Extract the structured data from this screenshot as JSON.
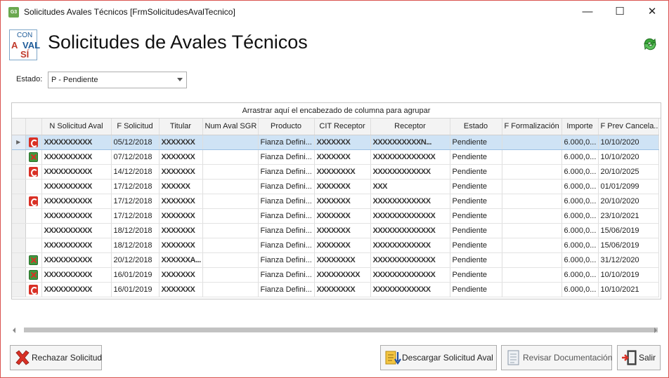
{
  "window": {
    "title": "Solicitudes Avales Técnicos [FrmSolicitudesAvalTecnico]",
    "app_icon_text": "G3",
    "minimize": "—",
    "maximize": "☐",
    "close": "✕"
  },
  "header": {
    "logo": {
      "line1": "CON",
      "line2": "A",
      "line3": "VAL",
      "line4": "SÍ"
    },
    "title": "Solicitudes de Avales Técnicos"
  },
  "filter": {
    "label": "Estado:",
    "value": "P - Pendiente"
  },
  "grid": {
    "group_panel": "Arrastrar aquí el encabezado de columna para agrupar",
    "columns": [
      "N Solicitud Aval",
      "F Solicitud",
      "Titular",
      "Num Aval SGR",
      "Producto",
      "CIT Receptor",
      "Receptor",
      "Estado",
      "F Formalización",
      "Importe",
      "F Prev Cancela..."
    ],
    "rows": [
      {
        "icon": "C",
        "n": "XXXXXXXXXX",
        "f": "05/12/2018",
        "titular": "XXXXXXX",
        "num": "",
        "producto": "Fianza Defini...",
        "cit": "XXXXXXX",
        "receptor": "XXXXXXXXXXN...",
        "estado": "Pendiente",
        "fform": "",
        "importe": "6.000,0...",
        "fprev": "10/10/2020"
      },
      {
        "icon": "X",
        "n": "XXXXXXXXXX",
        "f": "07/12/2018",
        "titular": "XXXXXXX",
        "num": "",
        "producto": "Fianza Defini...",
        "cit": "XXXXXXX",
        "receptor": "XXXXXXXXXXXXX",
        "estado": "Pendiente",
        "fform": "",
        "importe": "6.000,0...",
        "fprev": "10/10/2020"
      },
      {
        "icon": "C",
        "n": "XXXXXXXXXX",
        "f": "14/12/2018",
        "titular": "XXXXXXX",
        "num": "",
        "producto": "Fianza Defini...",
        "cit": "XXXXXXXX",
        "receptor": "XXXXXXXXXXXX",
        "estado": "Pendiente",
        "fform": "",
        "importe": "6.000,0...",
        "fprev": "20/10/2025"
      },
      {
        "icon": "",
        "n": "XXXXXXXXXX",
        "f": "17/12/2018",
        "titular": "XXXXXX",
        "num": "",
        "producto": "Fianza Defini...",
        "cit": "XXXXXXX",
        "receptor": "XXX",
        "estado": "Pendiente",
        "fform": "",
        "importe": "6.000,0...",
        "fprev": "01/01/2099"
      },
      {
        "icon": "C",
        "n": "XXXXXXXXXX",
        "f": "17/12/2018",
        "titular": "XXXXXXX",
        "num": "",
        "producto": "Fianza Defini...",
        "cit": "XXXXXXX",
        "receptor": "XXXXXXXXXXXX",
        "estado": "Pendiente",
        "fform": "",
        "importe": "6.000,0...",
        "fprev": "20/10/2020"
      },
      {
        "icon": "",
        "n": "XXXXXXXXXX",
        "f": "17/12/2018",
        "titular": "XXXXXXX",
        "num": "",
        "producto": "Fianza Defini...",
        "cit": "XXXXXXX",
        "receptor": "XXXXXXXXXXXXX",
        "estado": "Pendiente",
        "fform": "",
        "importe": "6.000,0...",
        "fprev": "23/10/2021"
      },
      {
        "icon": "",
        "n": "XXXXXXXXXX",
        "f": "18/12/2018",
        "titular": "XXXXXXX",
        "num": "",
        "producto": "Fianza Defini...",
        "cit": "XXXXXXX",
        "receptor": "XXXXXXXXXXXXX",
        "estado": "Pendiente",
        "fform": "",
        "importe": "6.000,0...",
        "fprev": "15/06/2019"
      },
      {
        "icon": "",
        "n": "XXXXXXXXXX",
        "f": "18/12/2018",
        "titular": "XXXXXXX",
        "num": "",
        "producto": "Fianza Defini...",
        "cit": "XXXXXXX",
        "receptor": "XXXXXXXXXXXX",
        "estado": "Pendiente",
        "fform": "",
        "importe": "6.000,0...",
        "fprev": "15/06/2019"
      },
      {
        "icon": "X",
        "n": "XXXXXXXXXX",
        "f": "20/12/2018",
        "titular": "XXXXXXA...",
        "num": "",
        "producto": "Fianza Defini...",
        "cit": "XXXXXXXX",
        "receptor": "XXXXXXXXXXXXX",
        "estado": "Pendiente",
        "fform": "",
        "importe": "6.000,0...",
        "fprev": "31/12/2020"
      },
      {
        "icon": "X",
        "n": "XXXXXXXXXX",
        "f": "16/01/2019",
        "titular": "XXXXXXX",
        "num": "",
        "producto": "Fianza Defini...",
        "cit": "XXXXXXXXX",
        "receptor": "XXXXXXXXXXXXX",
        "estado": "Pendiente",
        "fform": "",
        "importe": "6.000,0...",
        "fprev": "10/10/2019"
      },
      {
        "icon": "C",
        "n": "XXXXXXXXXX",
        "f": "16/01/2019",
        "titular": "XXXXXXX",
        "num": "",
        "producto": "Fianza Defini...",
        "cit": "XXXXXXXX",
        "receptor": "XXXXXXXXXXXX",
        "estado": "Pendiente",
        "fform": "",
        "importe": "6.000,0...",
        "fprev": "10/10/2021"
      }
    ]
  },
  "buttons": {
    "rechazar": "Rechazar Solicitud",
    "descargar": "Descargar Solicitud Aval",
    "revisar": "Revisar Documentación",
    "salir": "Salir"
  },
  "icons": {
    "rechazar": "red-x-icon",
    "descargar": "document-download-icon",
    "revisar": "document-review-icon",
    "salir": "exit-door-icon",
    "refresh": "green-refresh-icon"
  },
  "colors": {
    "selected_row": "#cfe3f5",
    "icon_c": "#d93025",
    "icon_x_bg": "#3f9a3f"
  }
}
